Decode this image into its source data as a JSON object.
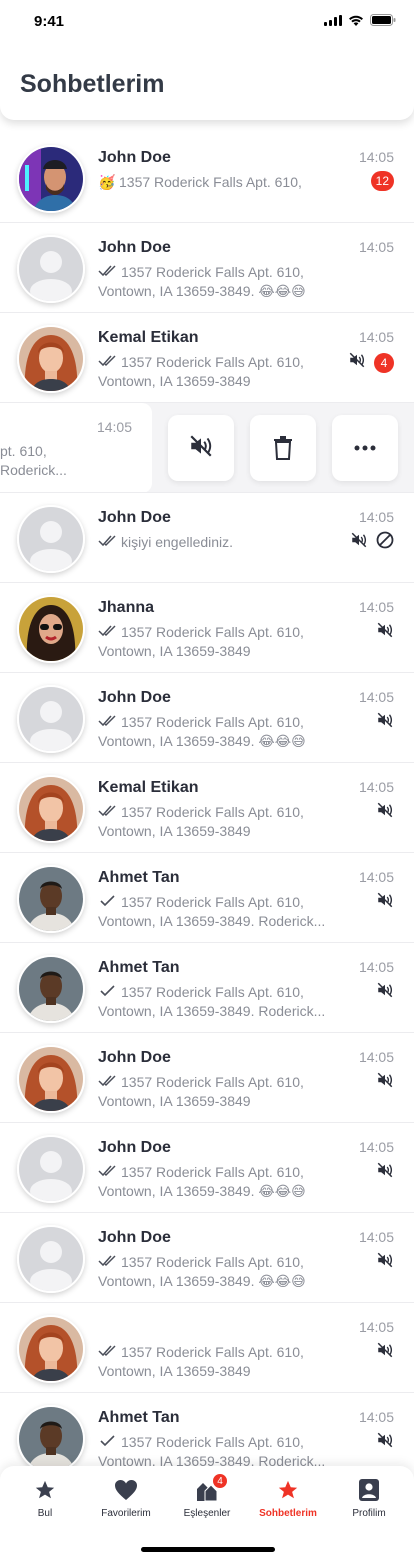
{
  "status": {
    "time": "9:41"
  },
  "header": {
    "title": "Sohbetlerim"
  },
  "chats": [
    {
      "name": "John Doe",
      "preview_l1": "1357 Roderick Falls Apt. 610,",
      "preview_l2": "",
      "time": "14:05",
      "badge": "12",
      "tick": "emoji",
      "muted": false,
      "blocked": false,
      "avatar": "man-neon"
    },
    {
      "name": "John Doe",
      "preview_l1": "1357 Roderick Falls Apt. 610,",
      "preview_l2": "Vontown, IA 13659-3849. 😂😂😅",
      "time": "14:05",
      "badge": "",
      "tick": "double",
      "muted": false,
      "blocked": false,
      "avatar": "placeholder"
    },
    {
      "name": "Kemal Etikan",
      "preview_l1": "1357 Roderick Falls Apt. 610,",
      "preview_l2": "Vontown, IA 13659-3849",
      "time": "14:05",
      "badge": "4",
      "tick": "double",
      "muted": true,
      "blocked": false,
      "avatar": "redhead"
    },
    {
      "name": "John Doe",
      "preview_l1": "kişiyi engellediniz.",
      "preview_l2": "",
      "time": "14:05",
      "badge": "",
      "tick": "double",
      "muted": true,
      "blocked": true,
      "avatar": "placeholder"
    },
    {
      "name": "Jhanna",
      "preview_l1": "1357 Roderick Falls Apt. 610,",
      "preview_l2": "Vontown, IA 13659-3849",
      "time": "14:05",
      "badge": "",
      "tick": "double",
      "muted": true,
      "blocked": false,
      "avatar": "sunglasses"
    },
    {
      "name": "John Doe",
      "preview_l1": "1357 Roderick Falls Apt. 610,",
      "preview_l2": "Vontown, IA 13659-3849. 😂😂😅",
      "time": "14:05",
      "badge": "",
      "tick": "double",
      "muted": true,
      "blocked": false,
      "avatar": "placeholder"
    },
    {
      "name": "Kemal Etikan",
      "preview_l1": "1357 Roderick Falls Apt. 610,",
      "preview_l2": "Vontown, IA 13659-3849",
      "time": "14:05",
      "badge": "",
      "tick": "double",
      "muted": true,
      "blocked": false,
      "avatar": "redhead"
    },
    {
      "name": "Ahmet Tan",
      "preview_l1": "1357 Roderick Falls Apt. 610,",
      "preview_l2": "Vontown, IA 13659-3849. Roderick...",
      "time": "14:05",
      "badge": "",
      "tick": "single",
      "muted": true,
      "blocked": false,
      "avatar": "dark-man"
    },
    {
      "name": "Ahmet Tan",
      "preview_l1": "1357 Roderick Falls Apt. 610,",
      "preview_l2": "Vontown, IA 13659-3849. Roderick...",
      "time": "14:05",
      "badge": "",
      "tick": "single",
      "muted": true,
      "blocked": false,
      "avatar": "dark-man"
    },
    {
      "name": "John Doe",
      "preview_l1": "1357 Roderick Falls Apt. 610,",
      "preview_l2": "Vontown, IA 13659-3849",
      "time": "14:05",
      "badge": "",
      "tick": "double",
      "muted": true,
      "blocked": false,
      "avatar": "redhead"
    },
    {
      "name": "John Doe",
      "preview_l1": "1357 Roderick Falls Apt. 610,",
      "preview_l2": "Vontown, IA 13659-3849. 😂😂😅",
      "time": "14:05",
      "badge": "",
      "tick": "double",
      "muted": true,
      "blocked": false,
      "avatar": "placeholder"
    },
    {
      "name": "John Doe",
      "preview_l1": "1357 Roderick Falls Apt. 610,",
      "preview_l2": "Vontown, IA 13659-3849. 😂😂😅",
      "time": "14:05",
      "badge": "",
      "tick": "double",
      "muted": true,
      "blocked": false,
      "avatar": "placeholder"
    },
    {
      "name": "",
      "preview_l1": "1357 Roderick Falls Apt. 610,",
      "preview_l2": "Vontown, IA 13659-3849",
      "time": "14:05",
      "badge": "",
      "tick": "double",
      "muted": true,
      "blocked": false,
      "avatar": "redhead"
    },
    {
      "name": "Ahmet Tan",
      "preview_l1": "1357 Roderick Falls Apt. 610,",
      "preview_l2": "Vontown, IA 13659-3849. Roderick...",
      "time": "14:05",
      "badge": "",
      "tick": "single",
      "muted": true,
      "blocked": false,
      "avatar": "dark-man"
    }
  ],
  "swiped": {
    "time": "14:05",
    "line1": "pt. 610,",
    "line2": " Roderick...",
    "actions": [
      "mute-icon",
      "trash-icon",
      "more-icon"
    ]
  },
  "tabs": [
    {
      "label": "Bul",
      "icon": "star-icon",
      "active": false,
      "badge": ""
    },
    {
      "label": "Favorilerim",
      "icon": "heart-icon",
      "active": false,
      "badge": ""
    },
    {
      "label": "Eşleşenler",
      "icon": "match-icon",
      "active": false,
      "badge": "4"
    },
    {
      "label": "Sohbetlerim",
      "icon": "chat-star-icon",
      "active": true,
      "badge": ""
    },
    {
      "label": "Profilim",
      "icon": "profile-icon",
      "active": false,
      "badge": ""
    }
  ],
  "colors": {
    "accent": "#ef3326",
    "text": "#2b2e3a",
    "muted_text": "#8a8d96"
  }
}
